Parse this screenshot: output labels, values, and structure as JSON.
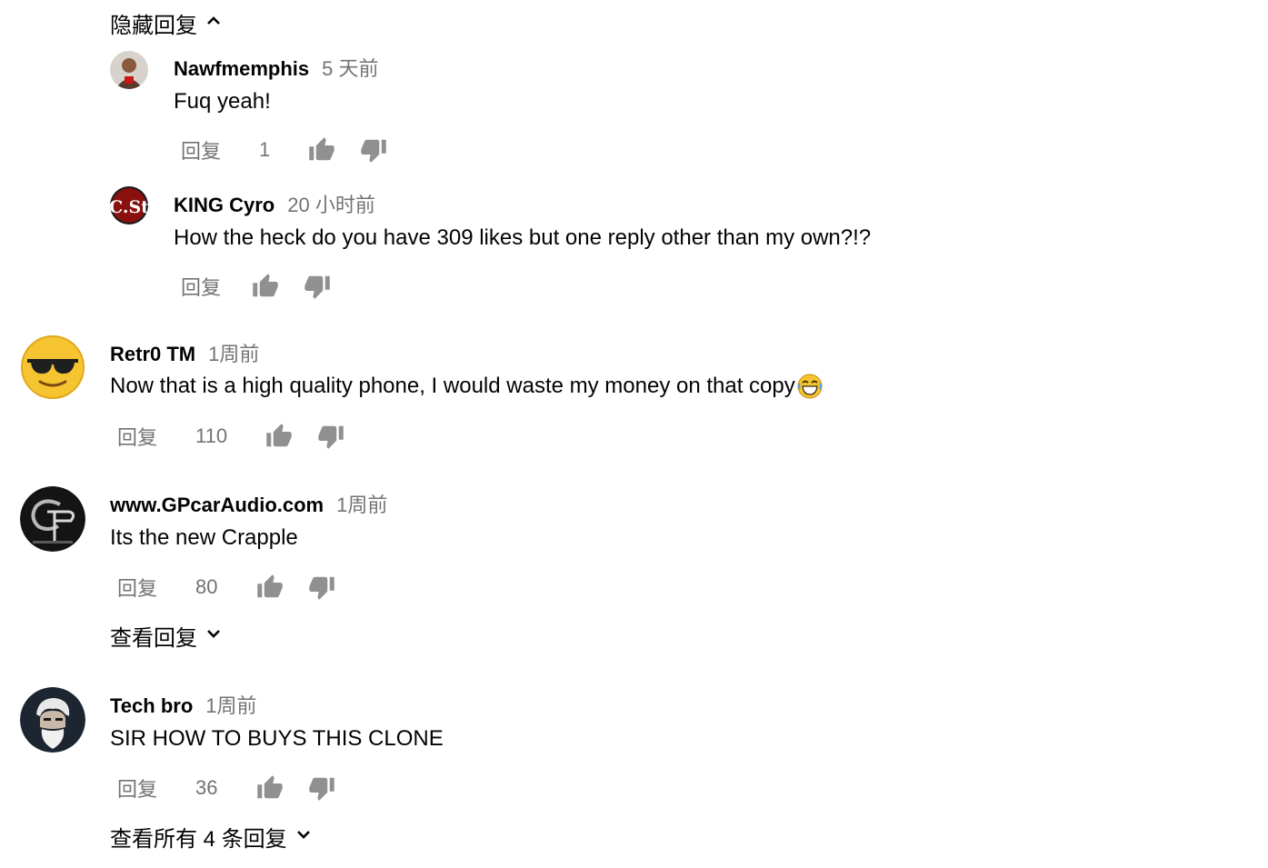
{
  "hide_replies_label": "隐藏回复",
  "comments": [
    {
      "author": "Nawfmemphis",
      "time": "5 天前",
      "text": "Fuq yeah!",
      "reply": "回复",
      "likes": "1"
    },
    {
      "author": "KING Cyro",
      "time": "20 小时前",
      "text": "How the heck do you have 309 likes but one reply other than my own?!?",
      "reply": "回复",
      "likes": ""
    },
    {
      "author": "Retr0 TM",
      "time": "1周前",
      "text": "Now that is a high quality phone, I would waste my money on that copy",
      "reply": "回复",
      "likes": "110"
    },
    {
      "author": "www.GPcarAudio.com",
      "time": "1周前",
      "text": "Its the new Crapple",
      "reply": "回复",
      "likes": "80"
    },
    {
      "author": "Tech bro",
      "time": "1周前",
      "text": "SIR HOW TO BUYS THIS CLONE",
      "reply": "回复",
      "likes": "36"
    }
  ],
  "view_replies_label": "查看回复",
  "view_all_replies_label": "查看所有 4 条回复",
  "avatar_labels": {
    "king_cyro": "C.St"
  },
  "colors": {
    "meta_text": "#737373",
    "primary_text": "#030303",
    "icon": "#909090"
  }
}
